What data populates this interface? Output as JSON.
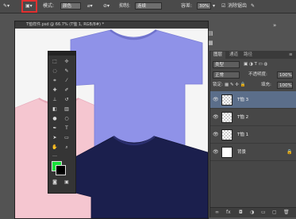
{
  "options_bar": {
    "mode_label": "模式:",
    "mode_value": "颜色",
    "smoothing_label": "抑制:",
    "smoothing_value": "连续",
    "tolerance_label": "容差:",
    "tolerance_value": "30%",
    "antialias_label": "消除锯齿"
  },
  "document": {
    "title": "T恤样件.psd @ 66.7% (T恤 1, RGB/8#) *"
  },
  "colors": {
    "foreground": "#18e03a",
    "background": "#000000",
    "highlight_box": "#e23030",
    "shirt_blue": "#8f92e8",
    "shirt_pink": "#f5c6d0",
    "shirt_navy": "#1b1f4d"
  },
  "layers_panel": {
    "tabs": [
      "图层",
      "通道",
      "路径"
    ],
    "kind_label": "类型",
    "blend_mode": "正常",
    "opacity_label": "不透明度:",
    "opacity_value": "100%",
    "lock_label": "锁定:",
    "fill_label": "填充:",
    "fill_value": "100%",
    "layers": [
      {
        "name": "T恤 3",
        "selected": true
      },
      {
        "name": "T恤 2",
        "selected": false
      },
      {
        "name": "T恤 1",
        "selected": false
      },
      {
        "name": "背景",
        "selected": false
      }
    ]
  }
}
